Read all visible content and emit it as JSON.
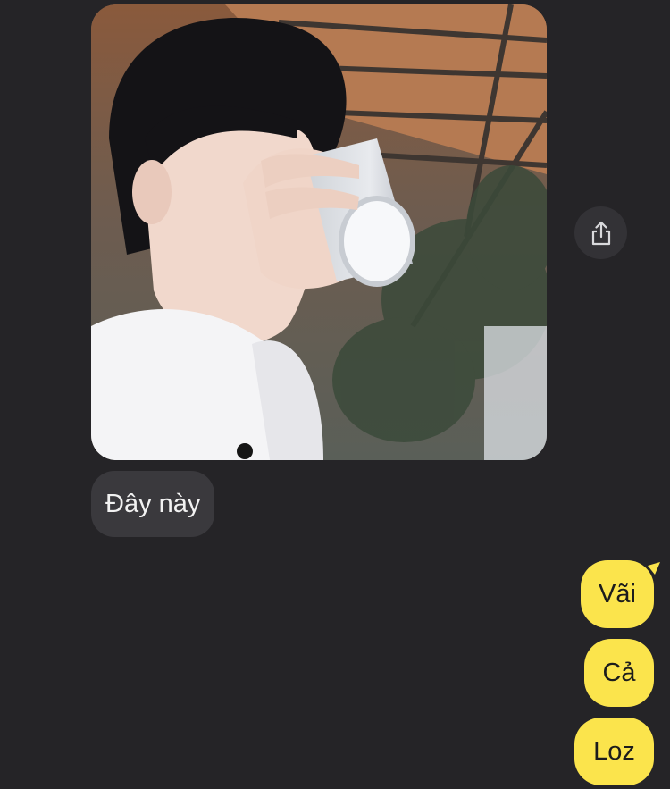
{
  "chat": {
    "received": {
      "photo_caption": "",
      "text": "Đây này"
    },
    "sent": [
      {
        "text": "Vãi"
      },
      {
        "text": "Cả"
      },
      {
        "text": "Loz"
      }
    ]
  },
  "icons": {
    "share": "share-icon"
  },
  "colors": {
    "background": "#252427",
    "received_bubble": "#3a393d",
    "sent_bubble": "#fbe44c",
    "share_button": "#333236"
  }
}
